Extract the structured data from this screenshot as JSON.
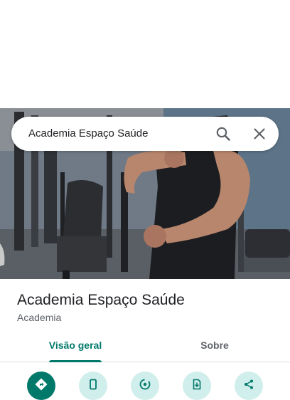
{
  "search": {
    "query": "Academia Espaço Saúde",
    "search_icon": "search-icon",
    "close_icon": "close-icon"
  },
  "place": {
    "name": "Academia Espaço Saúde",
    "category": "Academia"
  },
  "tabs": [
    {
      "label": "Visão geral",
      "active": true
    },
    {
      "label": "Sobre",
      "active": false
    }
  ],
  "actions": [
    {
      "icon": "directions-icon",
      "color": "#00796b"
    },
    {
      "icon": "phone-icon",
      "color": "#d0eeeb"
    },
    {
      "icon": "location-icon",
      "color": "#d0eeeb"
    },
    {
      "icon": "save-document-icon",
      "color": "#d0eeeb"
    },
    {
      "icon": "share-icon",
      "color": "#d0eeeb"
    }
  ],
  "colors": {
    "accent": "#00796b",
    "action_bg": "#d0eeeb",
    "text_primary": "#202124",
    "text_secondary": "#5f6368"
  }
}
